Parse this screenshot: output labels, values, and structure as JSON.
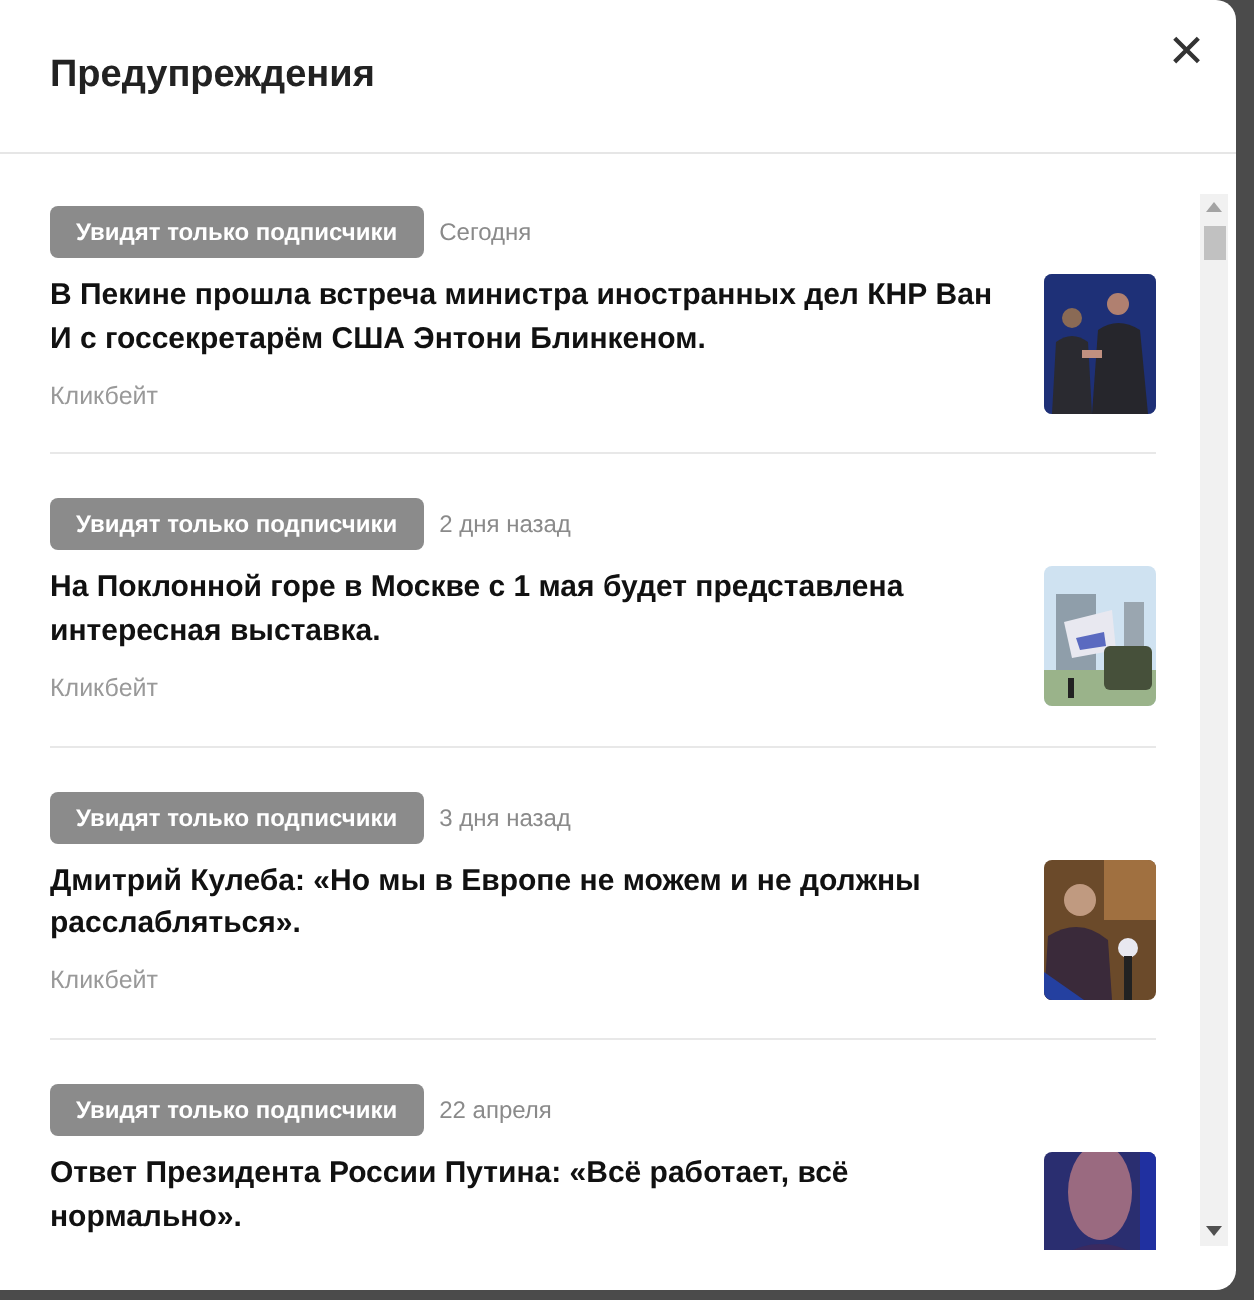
{
  "dialog": {
    "title": "Предупреждения",
    "close": "×"
  },
  "items": [
    {
      "badge": "Увидят только подписчики",
      "date": "Сегодня",
      "title": "В Пекине прошла встреча министра иностранных дел КНР Ван И с госсекретарём США Энтони Блинкеном.",
      "reason": "Кликбейт"
    },
    {
      "badge": "Увидят только подписчики",
      "date": "2 дня назад",
      "title": "На Поклонной горе в Москве с 1 мая будет представлена интересная выставка.",
      "reason": "Кликбейт"
    },
    {
      "badge": "Увидят только подписчики",
      "date": "3 дня назад",
      "title": "Дмитрий Кулеба: «Но мы в Европе не можем и не должны расслабляться».",
      "reason": "Кликбейт"
    },
    {
      "badge": "Увидят только подписчики",
      "date": "22 апреля",
      "title": "Ответ Президента России Путина: «Всё работает, всё нормально»."
    }
  ]
}
